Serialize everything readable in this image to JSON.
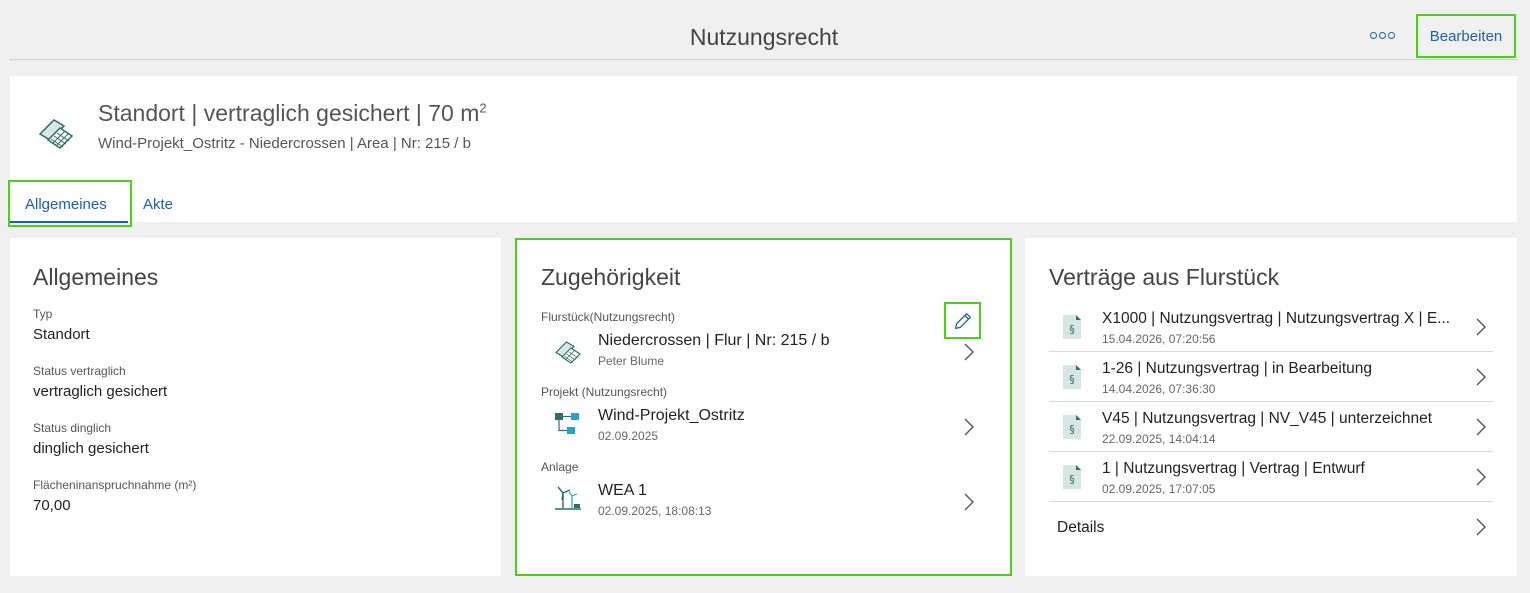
{
  "topbar": {
    "title": "Nutzungsrecht",
    "more_icon": "more-options-icon",
    "edit_label": "Bearbeiten"
  },
  "header": {
    "title": "Standort | vertraglich gesichert | 70 m",
    "title_sup": "2",
    "subtitle": "Wind-Projekt_Ostritz - Niedercrossen | Area | Nr: 215 / b",
    "icon": "parcel-icon",
    "tabs": [
      {
        "label": "Allgemeines",
        "active": true
      },
      {
        "label": "Akte",
        "active": false
      }
    ]
  },
  "general": {
    "title": "Allgemeines",
    "fields": [
      {
        "label": "Typ",
        "value": "Standort"
      },
      {
        "label": "Status vertraglich",
        "value": "vertraglich gesichert"
      },
      {
        "label": "Status dinglich",
        "value": "dinglich gesichert"
      },
      {
        "label": "Flächeninanspruchnahme (m²)",
        "value": "70,00"
      }
    ]
  },
  "membership": {
    "title": "Zugehörigkeit",
    "sections": [
      {
        "label": "Flurstück(Nutzungsrecht)",
        "item_title": "Niedercrossen | Flur | Nr: 215 / b",
        "item_sub": "Peter Blume",
        "icon": "parcel-icon"
      },
      {
        "label": "Projekt (Nutzungsrecht)",
        "item_title": "Wind-Projekt_Ostritz",
        "item_sub": "02.09.2025",
        "icon": "project-icon"
      },
      {
        "label": "Anlage",
        "item_title": "WEA 1",
        "item_sub": "02.09.2025, 18:08:13",
        "icon": "wind-turbine-icon"
      }
    ]
  },
  "contracts": {
    "title": "Verträge aus Flurstück",
    "items": [
      {
        "title": "X1000 | Nutzungsvertrag | Nutzungsvertrag X | E...",
        "date": "15.04.2026, 07:20:56"
      },
      {
        "title": "1-26 | Nutzungsvertrag | in Bearbeitung",
        "date": "14.04.2026, 07:36:30"
      },
      {
        "title": "V45 | Nutzungsvertrag | NV_V45 | unterzeichnet",
        "date": "22.09.2025, 14:04:14"
      },
      {
        "title": "1 | Nutzungsvertrag | Vertrag | Entwurf",
        "date": "02.09.2025, 17:07:05"
      }
    ],
    "details_label": "Details"
  },
  "colors": {
    "accent": "#1f5fa8",
    "highlight": "#4cd01a",
    "icon_teal": "#2e6e66",
    "icon_cyan": "#2aa3c7"
  }
}
